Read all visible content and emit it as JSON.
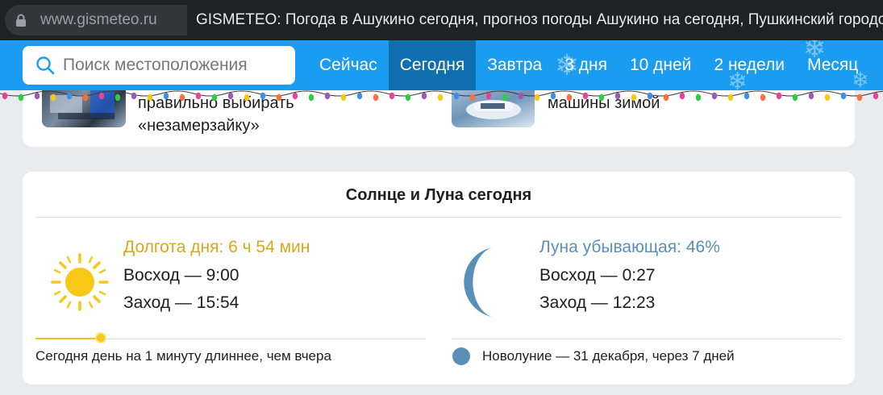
{
  "browser": {
    "url": "www.gismeteo.ru",
    "tab_title": "GISMETEO: Погода в Ашукино сегодня, прогноз погоды Ашукино на сегодня, Пушкинский городской"
  },
  "header": {
    "search_placeholder": "Поиск местоположения",
    "nav": [
      {
        "label": "Сейчас",
        "active": false
      },
      {
        "label": "Сегодня",
        "active": true
      },
      {
        "label": "Завтра",
        "active": false
      },
      {
        "label": "3 дня",
        "active": false
      },
      {
        "label": "10 дней",
        "active": false
      },
      {
        "label": "2 недели",
        "active": false
      },
      {
        "label": "Месяц",
        "active": false
      }
    ]
  },
  "news": {
    "item1_line1": "правильно выбирать",
    "item1_line2": "«незамерзайку»",
    "item2_line1": "машины зимой"
  },
  "sunmoon": {
    "title": "Солнце и Луна сегодня",
    "sun": {
      "day_length": "Долгота дня: 6 ч 54 мин",
      "sunrise": "Восход — 9:00",
      "sunset": "Заход — 15:54",
      "note": "Сегодня день на 1 минуту длиннее, чем вчера"
    },
    "moon": {
      "phase": "Луна убывающая: 46%",
      "moonrise": "Восход — 0:27",
      "moonset": "Заход — 12:23",
      "next": "Новолуние — 31 декабря, через 7 дней"
    }
  },
  "colors": {
    "header_bg": "#1a9cf0",
    "nav_active": "#0f6fb0",
    "sun": "#f7c815",
    "moon": "#5a8fb8"
  }
}
